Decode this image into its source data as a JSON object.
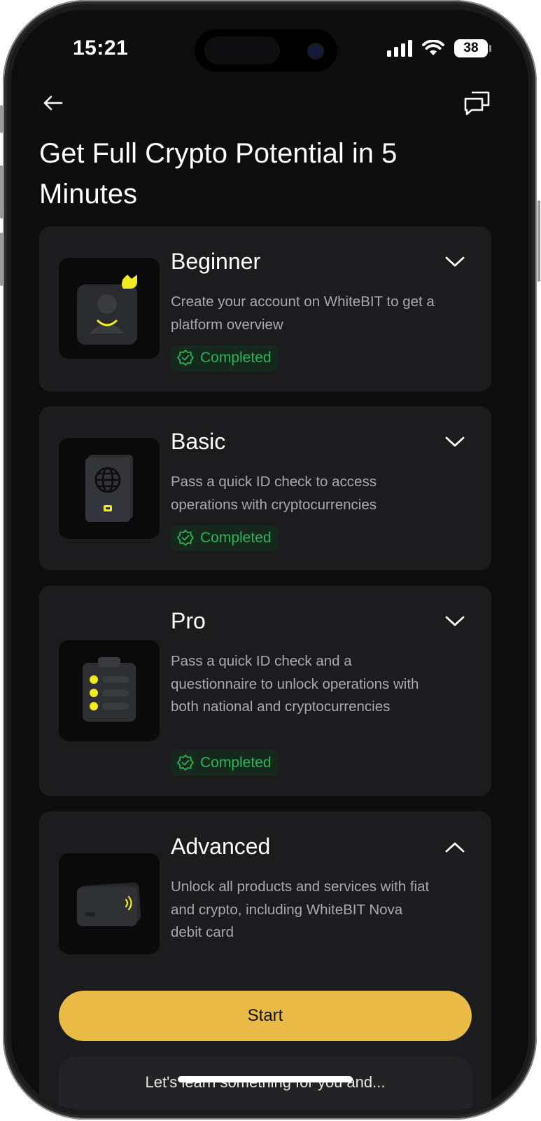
{
  "status_bar": {
    "time": "15:21",
    "battery": "38",
    "icons": [
      "cellular-signal-icon",
      "wifi-icon",
      "battery-icon"
    ]
  },
  "header": {
    "back_icon": "arrow-left-icon",
    "chat_icon": "chat-bubbles-icon",
    "title": "Get Full Crypto Potential in 5 Minutes"
  },
  "levels": [
    {
      "title": "Beginner",
      "description": "Create your account on WhiteBIT to get a platform overview",
      "status": "Completed",
      "expanded": false,
      "image_icon": "user-profile-icon"
    },
    {
      "title": "Basic",
      "description": "Pass a quick ID check to access operations with cryptocurrencies",
      "status": "Completed",
      "expanded": false,
      "image_icon": "passport-icon"
    },
    {
      "title": "Pro",
      "description": "Pass a quick ID check and a questionnaire to unlock operations with both national and cryptocurrencies",
      "status": "Completed",
      "expanded": false,
      "image_icon": "clipboard-checklist-icon"
    },
    {
      "title": "Advanced",
      "description": "Unlock all products and services with fiat and crypto, including WhiteBIT Nova debit card",
      "status": "",
      "expanded": true,
      "image_icon": "debit-card-icon"
    }
  ],
  "actions": {
    "start_label": "Start"
  },
  "bottom_card": {
    "text_partial": "Let's learn something for you and..."
  },
  "colors": {
    "background": "#0d0d0e",
    "card": "#1c1c1e",
    "accent_yellow": "#e9bb46",
    "success_green": "#2fb35a",
    "icon_yellow": "#f1ec1f"
  }
}
